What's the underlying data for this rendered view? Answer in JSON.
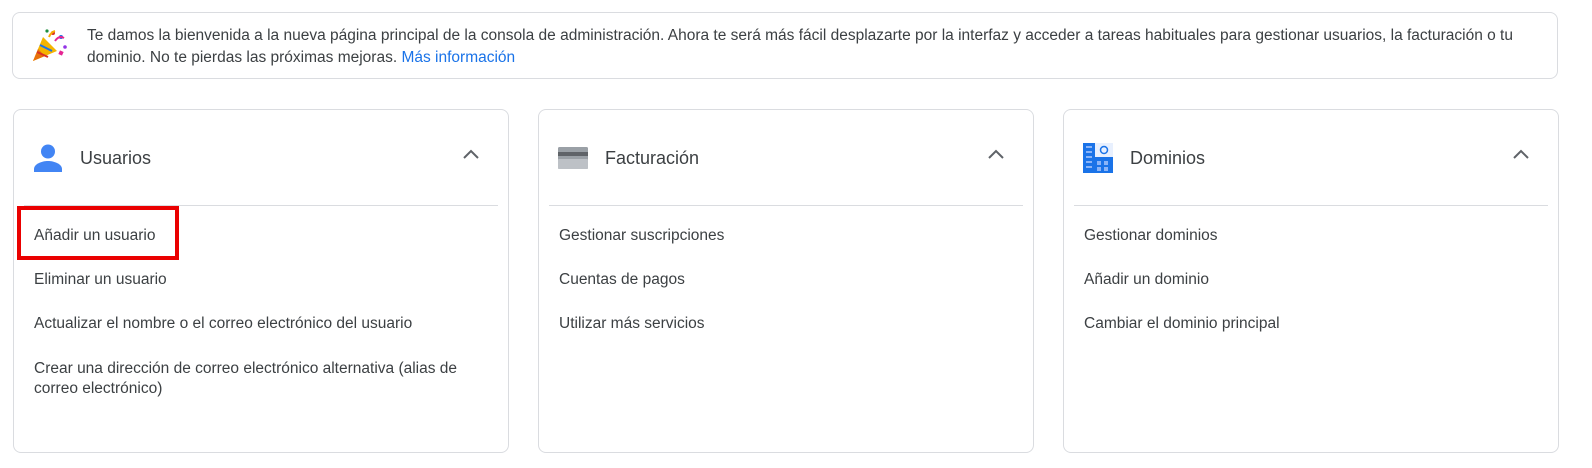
{
  "banner": {
    "text": "Te damos la bienvenida a la nueva página principal de la consola de administración. Ahora te será más fácil desplazarte por la interfaz y acceder a tareas habituales para gestionar usuarios, la facturación o tu dominio. No te pierdas las próximas mejoras.",
    "link": "Más información",
    "icon": "party-popper-icon"
  },
  "cards": [
    {
      "title": "Usuarios",
      "icon": "person-icon",
      "links": [
        "Añadir un usuario",
        "Eliminar un usuario",
        "Actualizar el nombre o el correo electrónico del usuario",
        "Crear una dirección de correo electrónico alternativa (alias de correo electrónico)"
      ]
    },
    {
      "title": "Facturación",
      "icon": "credit-card-icon",
      "links": [
        "Gestionar suscripciones",
        "Cuentas de pagos",
        "Utilizar más servicios"
      ]
    },
    {
      "title": "Dominios",
      "icon": "domains-icon",
      "links": [
        "Gestionar dominios",
        "Añadir un dominio",
        "Cambiar el dominio principal"
      ]
    }
  ],
  "colors": {
    "accent": "#1a73e8",
    "highlight": "#ea0000",
    "border": "#dadce0",
    "text": "#3c4043"
  }
}
